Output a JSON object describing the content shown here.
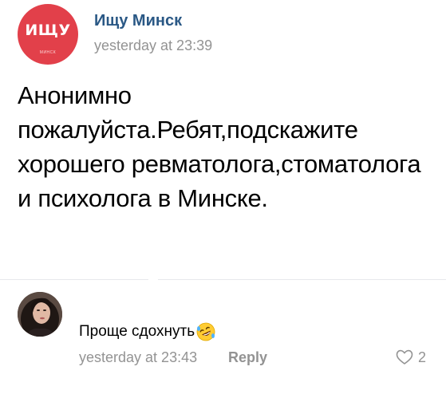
{
  "post": {
    "author": {
      "name": "Ищу Минск",
      "avatar_text": "ИЩУ",
      "avatar_subtext": "МИНСК",
      "avatar_color": "#e2404a"
    },
    "timestamp": "yesterday at 23:39",
    "text": "Анонимно пожалуйста.Ребят,подскажите хорошего ревматолога,стоматолога и психолога в Минске."
  },
  "comments": [
    {
      "text": "Проще сдохнуть",
      "emoji_icon": "rolling-on-floor-laughing-emoji-icon",
      "timestamp": "yesterday at 23:43",
      "reply_label": "Reply",
      "like_icon": "heart-outline-icon",
      "like_count": "2"
    }
  ],
  "colors": {
    "link_blue": "#2a5885",
    "meta_gray": "#939393",
    "divider": "#e7e8ec"
  }
}
